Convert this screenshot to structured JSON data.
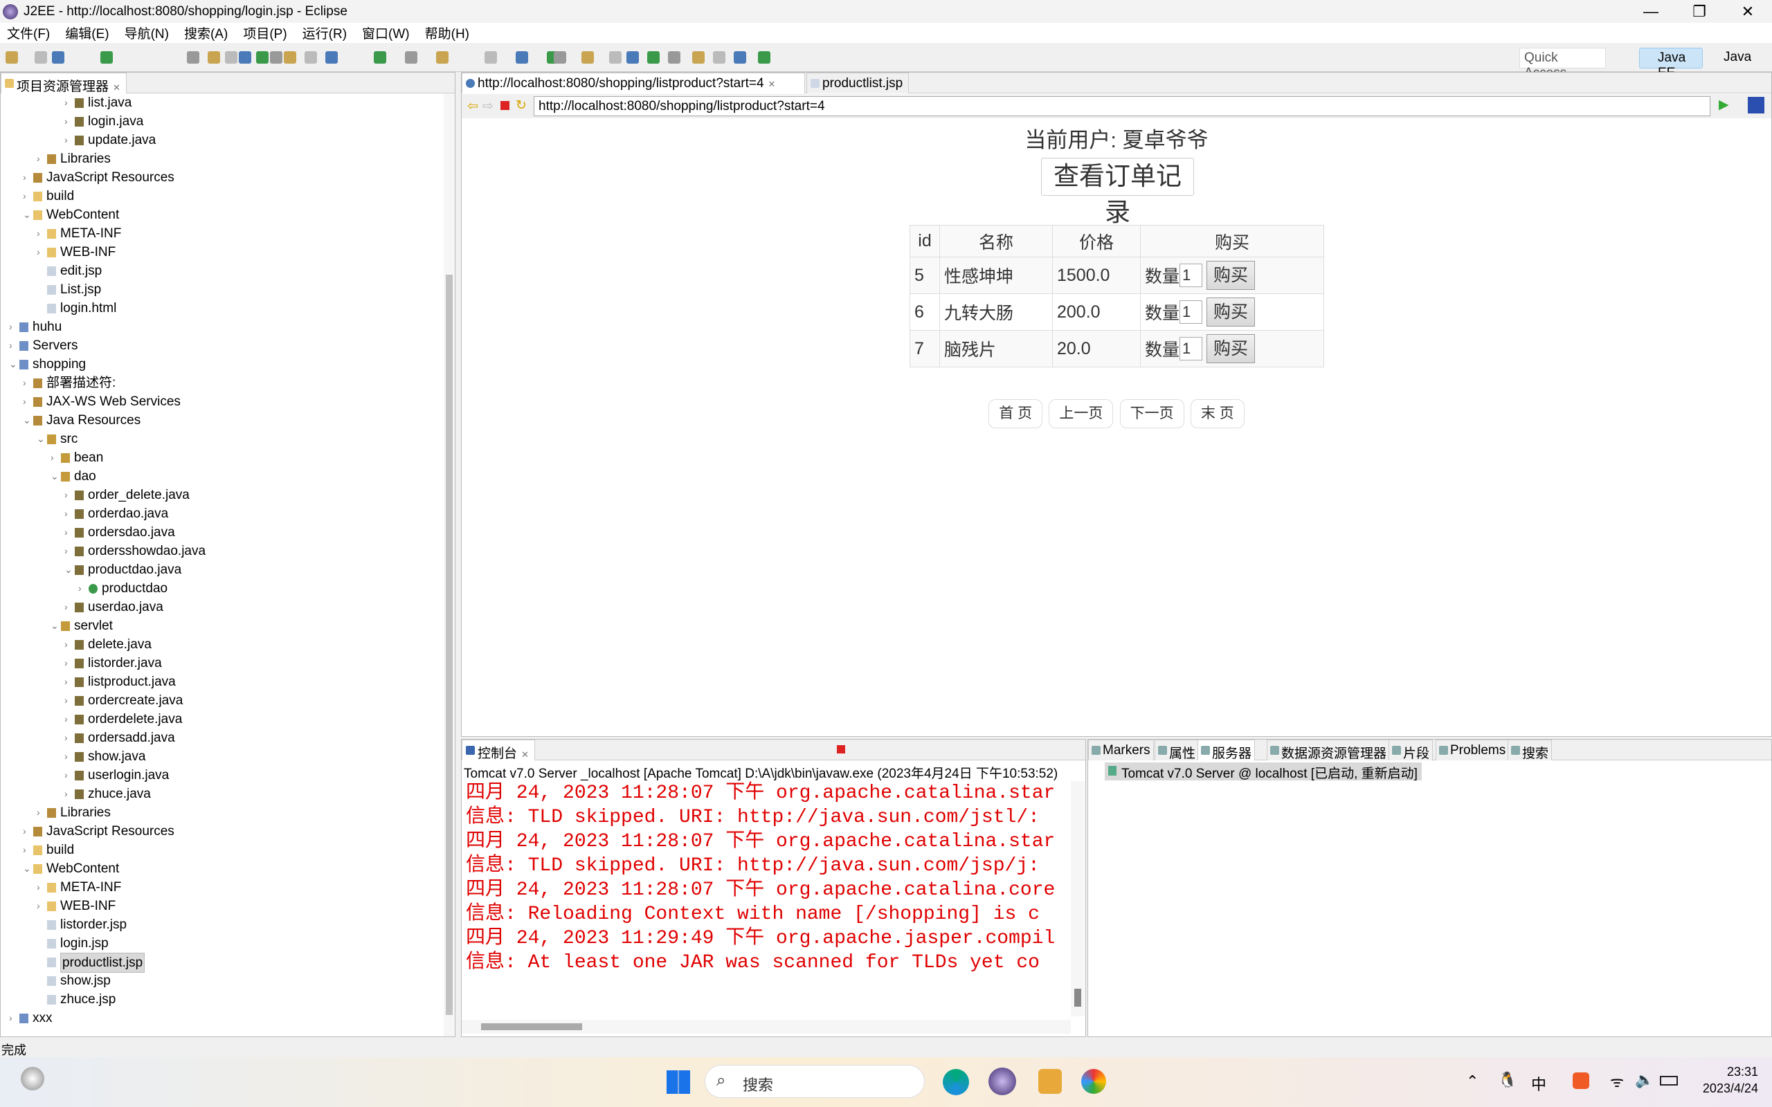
{
  "window": {
    "title": "J2EE - http://localhost:8080/shopping/login.jsp - Eclipse",
    "minimize": "—",
    "restore": "❐",
    "close": "✕"
  },
  "menu": [
    "文件(F)",
    "编辑(E)",
    "导航(N)",
    "搜索(A)",
    "项目(P)",
    "运行(R)",
    "窗口(W)",
    "帮助(H)"
  ],
  "toolbar": {
    "quick_access": "Quick Access",
    "perspectives": [
      "Java EE",
      "Java"
    ]
  },
  "explorer": {
    "tab": "项目资源管理器",
    "tree": [
      [
        "list.java",
        4,
        "c",
        "java"
      ],
      [
        "login.java",
        4,
        "c",
        "java"
      ],
      [
        "update.java",
        4,
        "c",
        "java"
      ],
      [
        "Libraries",
        2,
        "c",
        "lib"
      ],
      [
        "JavaScript Resources",
        1,
        "c",
        "lib"
      ],
      [
        "build",
        1,
        "c",
        "folder"
      ],
      [
        "WebContent",
        1,
        "e",
        "folder"
      ],
      [
        "META-INF",
        2,
        "c",
        "folder"
      ],
      [
        "WEB-INF",
        2,
        "c",
        "folder"
      ],
      [
        "edit.jsp",
        2,
        "",
        "file"
      ],
      [
        "List.jsp",
        2,
        "",
        "file"
      ],
      [
        "login.html",
        2,
        "",
        "file"
      ],
      [
        "huhu",
        0,
        "c",
        "project"
      ],
      [
        "Servers",
        0,
        "c",
        "project"
      ],
      [
        "shopping",
        0,
        "e",
        "project"
      ],
      [
        "部署描述符:",
        1,
        "c",
        "lib"
      ],
      [
        "JAX-WS Web Services",
        1,
        "c",
        "lib"
      ],
      [
        "Java Resources",
        1,
        "e",
        "lib"
      ],
      [
        "src",
        2,
        "e",
        "pkg"
      ],
      [
        "bean",
        3,
        "c",
        "pkg"
      ],
      [
        "dao",
        3,
        "e",
        "pkg"
      ],
      [
        "order_delete.java",
        4,
        "c",
        "java"
      ],
      [
        "orderdao.java",
        4,
        "c",
        "java"
      ],
      [
        "ordersdao.java",
        4,
        "c",
        "java"
      ],
      [
        "ordersshowdao.java",
        4,
        "c",
        "java"
      ],
      [
        "productdao.java",
        4,
        "e",
        "java"
      ],
      [
        "productdao",
        5,
        "c",
        "class"
      ],
      [
        "userdao.java",
        4,
        "c",
        "java"
      ],
      [
        "servlet",
        3,
        "e",
        "pkg"
      ],
      [
        "delete.java",
        4,
        "c",
        "java"
      ],
      [
        "listorder.java",
        4,
        "c",
        "java"
      ],
      [
        "listproduct.java",
        4,
        "c",
        "java"
      ],
      [
        "ordercreate.java",
        4,
        "c",
        "java"
      ],
      [
        "orderdelete.java",
        4,
        "c",
        "java"
      ],
      [
        "ordersadd.java",
        4,
        "c",
        "java"
      ],
      [
        "show.java",
        4,
        "c",
        "java"
      ],
      [
        "userlogin.java",
        4,
        "c",
        "java"
      ],
      [
        "zhuce.java",
        4,
        "c",
        "java"
      ],
      [
        "Libraries",
        2,
        "c",
        "lib"
      ],
      [
        "JavaScript Resources",
        1,
        "c",
        "lib"
      ],
      [
        "build",
        1,
        "c",
        "folder"
      ],
      [
        "WebContent",
        1,
        "e",
        "folder"
      ],
      [
        "META-INF",
        2,
        "c",
        "folder"
      ],
      [
        "WEB-INF",
        2,
        "c",
        "folder"
      ],
      [
        "listorder.jsp",
        2,
        "",
        "file"
      ],
      [
        "login.jsp",
        2,
        "",
        "file"
      ],
      [
        "productlist.jsp",
        2,
        "sel",
        "file"
      ],
      [
        "show.jsp",
        2,
        "",
        "file"
      ],
      [
        "zhuce.jsp",
        2,
        "",
        "file"
      ],
      [
        "xxx",
        0,
        "c",
        "project"
      ]
    ]
  },
  "editor": {
    "tabs": [
      "http://localhost:8080/shopping/listproduct?start=4",
      "productlist.jsp"
    ],
    "url": "http://localhost:8080/shopping/listproduct?start=4"
  },
  "page": {
    "current_user": "当前用户: 夏卓爷爷",
    "orders_button": "查看订单记录",
    "headers": [
      "id",
      "名称",
      "价格",
      "购买"
    ],
    "rows": [
      {
        "id": "5",
        "name": "性感坤坤",
        "price": "1500.0",
        "qty_label": "数量",
        "qty": "1",
        "buy": "购买"
      },
      {
        "id": "6",
        "name": "九转大肠",
        "price": "200.0",
        "qty_label": "数量",
        "qty": "1",
        "buy": "购买"
      },
      {
        "id": "7",
        "name": "脑残片",
        "price": "20.0",
        "qty_label": "数量",
        "qty": "1",
        "buy": "购买"
      }
    ],
    "pager": [
      "首 页",
      "上一页",
      "下一页",
      "末 页"
    ]
  },
  "console": {
    "tab": "控制台",
    "header": "Tomcat v7.0 Server _localhost [Apache Tomcat] D:\\A\\jdk\\bin\\javaw.exe  (2023年4月24日 下午10:53:52)",
    "lines": [
      "四月 24, 2023 11:28:07 下午 org.apache.catalina.star",
      "信息: TLD skipped. URI: http://java.sun.com/jstl/:",
      "四月 24, 2023 11:28:07 下午 org.apache.catalina.star",
      "信息: TLD skipped. URI: http://java.sun.com/jsp/j:",
      "四月 24, 2023 11:28:07 下午 org.apache.catalina.core",
      "信息: Reloading Context with name [/shopping] is c",
      "四月 24, 2023 11:29:49 下午 org.apache.jasper.compil",
      "信息: At least one JAR was scanned for TLDs yet co"
    ],
    "color": "#e00000"
  },
  "servers": {
    "tabs": [
      "Markers",
      "属性",
      "服务器",
      "数据源资源管理器",
      "片段",
      "Problems",
      "搜索"
    ],
    "server": "Tomcat v7.0 Server @ localhost  [已启动, 重新启动]"
  },
  "status": "完成",
  "taskbar": {
    "search": "搜索",
    "time": "23:31",
    "date": "2023/4/24",
    "ime": "中"
  }
}
